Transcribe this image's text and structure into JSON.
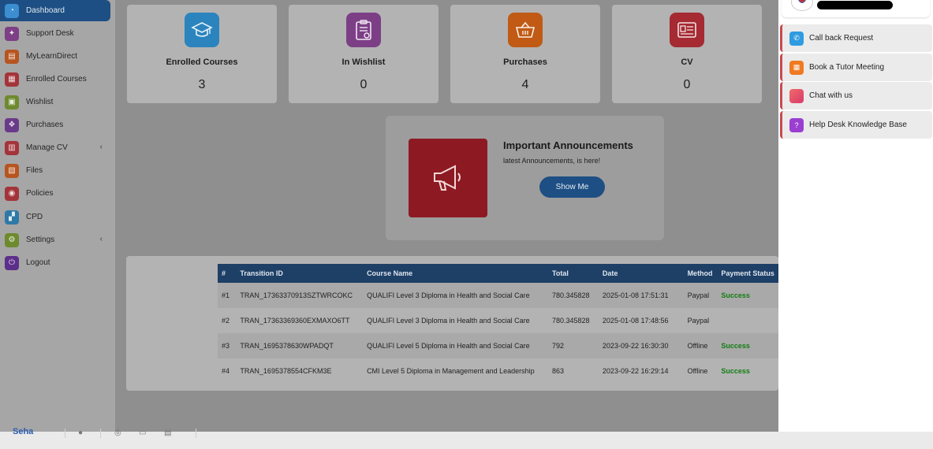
{
  "sidebar": {
    "items": [
      {
        "label": "Dashboard",
        "icon": "dashboard-icon",
        "color": "#3b8ed0",
        "active": true
      },
      {
        "label": "Support Desk",
        "icon": "support-icon",
        "color": "#7e3f86"
      },
      {
        "label": "MyLearnDirect",
        "icon": "learn-icon",
        "color": "#b65520"
      },
      {
        "label": "Enrolled Courses",
        "icon": "courses-icon",
        "color": "#a3343a"
      },
      {
        "label": "Wishlist",
        "icon": "wishlist-icon",
        "color": "#6e8a2e"
      },
      {
        "label": "Purchases",
        "icon": "purchases-icon",
        "color": "#6a3a8a"
      },
      {
        "label": "Manage CV",
        "icon": "cv-icon",
        "color": "#a3343a",
        "chevron": "‹"
      },
      {
        "label": "Files",
        "icon": "files-icon",
        "color": "#b65520"
      },
      {
        "label": "Policies",
        "icon": "policies-icon",
        "color": "#a3343a"
      },
      {
        "label": "CPD",
        "icon": "cpd-icon",
        "color": "#2e79a6"
      },
      {
        "label": "Settings",
        "icon": "settings-icon",
        "color": "#6e8a2e",
        "chevron": "‹"
      },
      {
        "label": "Logout",
        "icon": "logout-icon",
        "color": "#5c2f8a"
      }
    ]
  },
  "cards": [
    {
      "title": "Enrolled Courses",
      "value": "3",
      "icon": "graduation-cap-icon",
      "color": "#2b84bd"
    },
    {
      "title": "In Wishlist",
      "value": "0",
      "icon": "clipboard-heart-icon",
      "color": "#7c3f86"
    },
    {
      "title": "Purchases",
      "value": "4",
      "icon": "basket-icon",
      "color": "#c05a14"
    },
    {
      "title": "CV",
      "value": "0",
      "icon": "cv-document-icon",
      "color": "#a52a32"
    }
  ],
  "announcement": {
    "title": "Important Announcements",
    "subtitle": "latest Announcements, is here!",
    "button": "Show Me",
    "icon": "megaphone-icon"
  },
  "table": {
    "headers": [
      "#",
      "Transition ID",
      "Course Name",
      "Total",
      "Date",
      "Method",
      "Payment Status"
    ],
    "rows": [
      [
        "#1",
        "TRAN_17363370913SZTWRCOKC",
        "QUALIFI Level 3 Diploma in Health and Social Care",
        "780.345828",
        "2025-01-08 17:51:31",
        "Paypal",
        "Success"
      ],
      [
        "#2",
        "TRAN_17363369360EXMAXO6TT",
        "QUALIFI Level 3 Diploma in Health and Social Care",
        "780.345828",
        "2025-01-08 17:48:56",
        "Paypal",
        ""
      ],
      [
        "#3",
        "TRAN_1695378630WPADQT",
        "QUALIFI Level 5 Diploma in Health and Social Care",
        "792",
        "2023-09-22 16:30:30",
        "Offline",
        "Success"
      ],
      [
        "#4",
        "TRAN_1695378554CFKM3E",
        "CMI Level 5 Diploma in Management and Leadership",
        "863",
        "2023-09-22 16:29:14",
        "Offline",
        "Success"
      ]
    ]
  },
  "right_panel": {
    "items": [
      {
        "label": "Call back Request",
        "icon": "phone-icon",
        "color": "#2f9be0"
      },
      {
        "label": "Book a Tutor Meeting",
        "icon": "calendar-icon",
        "color": "#ef7a22"
      },
      {
        "label": "Chat with us",
        "icon": "chat-icon",
        "color": "#e24a5a"
      },
      {
        "label": "Help Desk Knowledge Base",
        "icon": "help-icon",
        "color": "#9a3fd0"
      }
    ]
  },
  "bottom_bar": {
    "logo": "Seha"
  }
}
